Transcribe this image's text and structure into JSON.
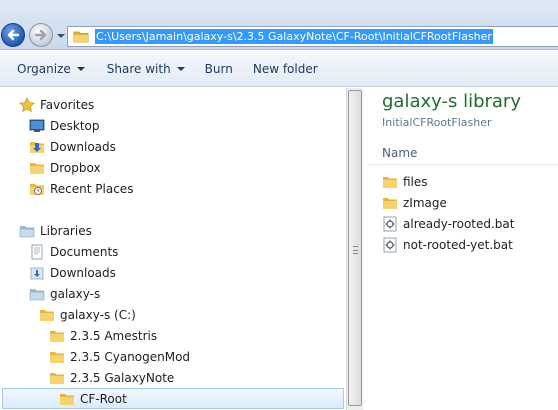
{
  "address": {
    "path": "C:\\Users\\Jamain\\galaxy-s\\2.3.5 GalaxyNote\\CF-Root\\InitialCFRootFlasher"
  },
  "toolbar": {
    "organize": "Organize",
    "share_with": "Share with",
    "burn": "Burn",
    "new_folder": "New folder"
  },
  "nav": {
    "favorites": "Favorites",
    "desktop": "Desktop",
    "downloads": "Downloads",
    "dropbox": "Dropbox",
    "recent_places": "Recent Places",
    "libraries": "Libraries",
    "documents": "Documents",
    "lib_downloads": "Downloads",
    "galaxy_s": "galaxy-s",
    "galaxy_s_c": "galaxy-s (C:)",
    "amestris": "2.3.5 Amestris",
    "cyanogenmod": "2.3.5 CyanogenMod",
    "galaxynote": "2.3.5 GalaxyNote",
    "cf_root": "CF-Root"
  },
  "content": {
    "library_title": "galaxy-s library",
    "library_subtitle": "InitialCFRootFlasher",
    "column_name": "Name",
    "files": [
      "files",
      "zImage",
      "already-rooted.bat",
      "not-rooted-yet.bat"
    ]
  },
  "colors": {
    "selection": "#3399ff",
    "library_title": "#1e6d2e",
    "folder": "#e8b73a"
  }
}
